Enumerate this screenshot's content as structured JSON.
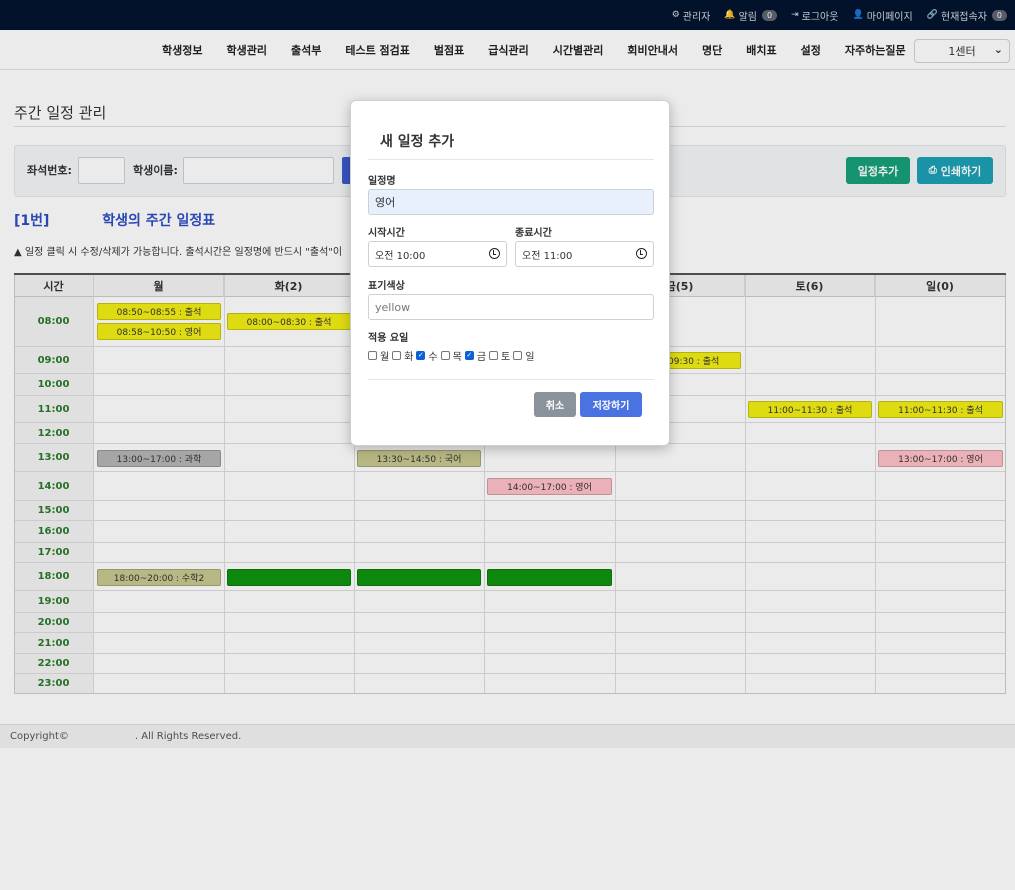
{
  "topbar": {
    "items": [
      {
        "icon": "gear-icon",
        "glyph": "⚙",
        "label": "관리자",
        "badge": null
      },
      {
        "icon": "bell-icon",
        "glyph": "🔔",
        "label": "알림",
        "badge": "0"
      },
      {
        "icon": "logout-icon",
        "glyph": "⇥",
        "label": "로그아웃",
        "badge": null
      },
      {
        "icon": "user-icon",
        "glyph": "👤",
        "label": "마이페이지",
        "badge": null
      },
      {
        "icon": "link-icon",
        "glyph": "🔗",
        "label": "현재접속자",
        "badge": "0"
      }
    ]
  },
  "nav": {
    "menu": [
      "학생정보",
      "학생관리",
      "출석부",
      "테스트 점검표",
      "벌점표",
      "급식관리",
      "시간별관리",
      "회비안내서",
      "명단",
      "배치표",
      "설정",
      "자주하는질문"
    ],
    "center_select": "1센터"
  },
  "page": {
    "title": "주간 일정 관리",
    "filter": {
      "seat_label": "좌석번호:",
      "name_label": "학생이름:",
      "add_button": "일정추가",
      "print_button": "인쇄하기"
    },
    "schedule_title_num": "[1번]",
    "schedule_title_text": "학생의 주간 일정표",
    "notice": "일정 클릭 시 수정/삭제가 가능합니다. 출석시간은 일정명에 반드시 \"출석\"이"
  },
  "grid": {
    "headers": [
      "시간",
      "월",
      "화(2)",
      "",
      "",
      "금(5)",
      "토(6)",
      "일(0)"
    ],
    "hours": [
      "08:00",
      "09:00",
      "10:00",
      "11:00",
      "12:00",
      "13:00",
      "14:00",
      "15:00",
      "16:00",
      "17:00",
      "18:00",
      "19:00",
      "20:00",
      "21:00",
      "22:00",
      "23:00"
    ],
    "events": [
      {
        "day": 0,
        "hour": 0,
        "slot": 0,
        "text": "08:50~08:55 : 출석",
        "color": "yellow"
      },
      {
        "day": 0,
        "hour": 0,
        "slot": 1,
        "text": "08:58~10:50 : 영어",
        "color": "yellow"
      },
      {
        "day": 1,
        "hour": 0,
        "slot": 2,
        "text": "08:00~08:30 : 출석",
        "color": "yellow"
      },
      {
        "day": 4,
        "hour": 1,
        "slot": 0,
        "text": "09:30 : 출석",
        "color": "yellow",
        "align": "right"
      },
      {
        "day": 5,
        "hour": 3,
        "slot": 0,
        "text": "11:00~11:30 : 출석",
        "color": "yellow"
      },
      {
        "day": 6,
        "hour": 3,
        "slot": 0,
        "text": "11:00~11:30 : 출석",
        "color": "yellow"
      },
      {
        "day": 0,
        "hour": 5,
        "slot": 0,
        "text": "13:00~17:00 : 과학",
        "color": "gray"
      },
      {
        "day": 2,
        "hour": 5,
        "slot": 0,
        "text": "13:30~14:50 : 국어",
        "color": "khaki"
      },
      {
        "day": 6,
        "hour": 5,
        "slot": 0,
        "text": "13:00~17:00 : 영어",
        "color": "pink"
      },
      {
        "day": 3,
        "hour": 6,
        "slot": 0,
        "text": "14:00~17:00 : 영어",
        "color": "pink"
      },
      {
        "day": 0,
        "hour": 10,
        "slot": 0,
        "text": "18:00~20:00 : 수학2",
        "color": "khaki"
      },
      {
        "day": 1,
        "hour": 10,
        "slot": 0,
        "text": "",
        "color": "green"
      },
      {
        "day": 2,
        "hour": 10,
        "slot": 0,
        "text": "",
        "color": "green"
      },
      {
        "day": 3,
        "hour": 10,
        "slot": 0,
        "text": "",
        "color": "green"
      }
    ]
  },
  "footer": {
    "left": "Copyright©",
    "right": ". All Rights Reserved."
  },
  "modal": {
    "title": "새 일정 추가",
    "name_label": "일정명",
    "name_value": "영어",
    "start_label": "시작시간",
    "start_value": "오전 10:00",
    "end_label": "종료시간",
    "end_value": "오전 11:00",
    "color_label": "표기색상",
    "color_placeholder": "yellow",
    "days_label": "적용 요일",
    "days": [
      {
        "label": "월",
        "checked": false
      },
      {
        "label": "화",
        "checked": false
      },
      {
        "label": "수",
        "checked": true
      },
      {
        "label": "목",
        "checked": false
      },
      {
        "label": "금",
        "checked": true
      },
      {
        "label": "토",
        "checked": false
      },
      {
        "label": "일",
        "checked": false
      }
    ],
    "cancel_label": "취소",
    "save_label": "저장하기"
  }
}
